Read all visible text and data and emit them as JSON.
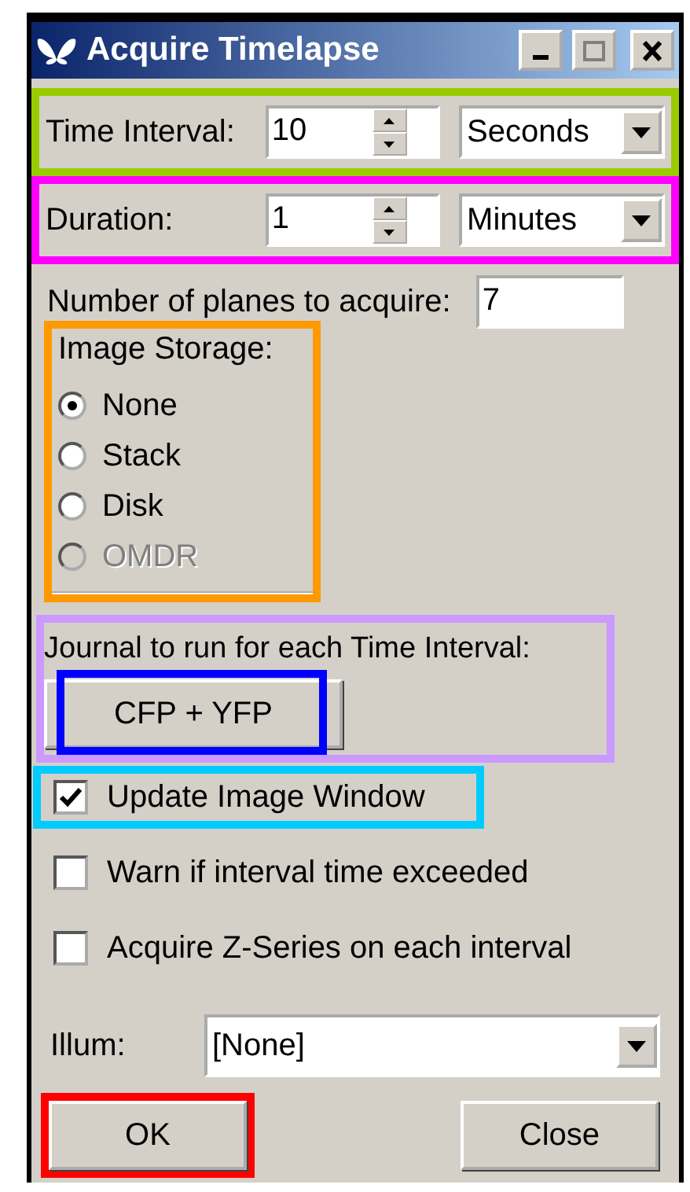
{
  "window": {
    "title": "Acquire Timelapse"
  },
  "time_interval": {
    "label": "Time Interval:",
    "value": "10",
    "unit": "Seconds",
    "color": "#99cc00"
  },
  "duration": {
    "label": "Duration:",
    "value": "1",
    "unit": "Minutes",
    "color": "#ff00ff"
  },
  "planes": {
    "label": "Number of planes to acquire:",
    "value": "7"
  },
  "image_storage": {
    "title": "Image Storage:",
    "color": "#ff9900",
    "options": [
      {
        "label": "None",
        "selected": true,
        "disabled": false
      },
      {
        "label": "Stack",
        "selected": false,
        "disabled": false
      },
      {
        "label": "Disk",
        "selected": false,
        "disabled": false
      },
      {
        "label": "OMDR",
        "selected": false,
        "disabled": true
      }
    ]
  },
  "journal": {
    "label": "Journal to run for each Time Interval:",
    "color": "#cc99ff",
    "button": {
      "label": "CFP + YFP",
      "color": "#0000ff"
    }
  },
  "checkboxes": [
    {
      "label": "Update Image Window",
      "checked": true,
      "color": "#00ccff"
    },
    {
      "label": "Warn if interval time exceeded",
      "checked": false
    },
    {
      "label": "Acquire Z-Series on each interval",
      "checked": false
    }
  ],
  "illum": {
    "label": "Illum:",
    "value": "[None]"
  },
  "buttons": [
    {
      "label": "OK",
      "color": "#ff0000"
    },
    {
      "label": "Close"
    }
  ]
}
